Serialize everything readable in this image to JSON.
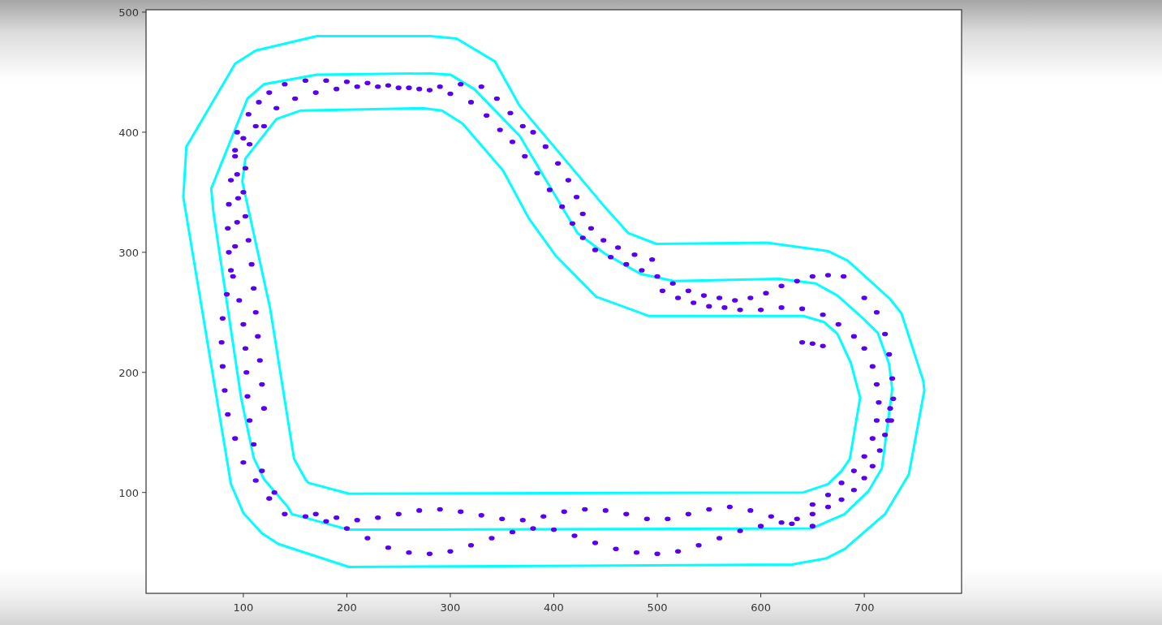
{
  "plot": {
    "chart_data": {
      "type": "scatter",
      "xlim": [
        6,
        794
      ],
      "ylim": [
        16,
        502
      ],
      "xticks": [
        100,
        200,
        300,
        400,
        500,
        600,
        700
      ],
      "yticks": [
        100,
        200,
        300,
        400,
        500
      ],
      "x": [
        725,
        723,
        720,
        715,
        708,
        700,
        690,
        678,
        665,
        650,
        635,
        620,
        600,
        580,
        560,
        540,
        520,
        500,
        480,
        460,
        440,
        420,
        400,
        380,
        360,
        340,
        320,
        300,
        280,
        260,
        240,
        220,
        200,
        180,
        160,
        140,
        650,
        630,
        610,
        590,
        570,
        550,
        530,
        510,
        490,
        470,
        450,
        430,
        410,
        390,
        370,
        350,
        330,
        310,
        290,
        270,
        250,
        230,
        210,
        190,
        170,
        125,
        112,
        100,
        92,
        85,
        82,
        80,
        79,
        80,
        84,
        88,
        92,
        94,
        95,
        94,
        92,
        94,
        130,
        118,
        110,
        106,
        104,
        103,
        102,
        100,
        96,
        90,
        86,
        85,
        86,
        88,
        92,
        100,
        120,
        118,
        116,
        114,
        112,
        110,
        108,
        105,
        102,
        100,
        102,
        106,
        112,
        105,
        115,
        125,
        140,
        160,
        180,
        200,
        220,
        240,
        260,
        280,
        300,
        320,
        335,
        348,
        120,
        132,
        150,
        170,
        190,
        210,
        230,
        250,
        270,
        290,
        310,
        330,
        345,
        358,
        370,
        360,
        372,
        384,
        396,
        408,
        418,
        428,
        440,
        455,
        470,
        485,
        380,
        392,
        404,
        414,
        422,
        428,
        436,
        448,
        462,
        478,
        495,
        500,
        515,
        530,
        545,
        560,
        575,
        590,
        605,
        620,
        635,
        650,
        665,
        680,
        505,
        520,
        535,
        550,
        565,
        580,
        600,
        620,
        640,
        660,
        675,
        690,
        700,
        708,
        712,
        714,
        712,
        708,
        700,
        690,
        678,
        665,
        650,
        640,
        650,
        660,
        700,
        712,
        720,
        724,
        727,
        728,
        726
      ],
      "series": [
        {
          "color": "#5a00f0",
          "values": [
            170,
            160,
            148,
            135,
            122,
            112,
            102,
            94,
            88,
            82,
            78,
            75,
            72,
            68,
            62,
            56,
            51,
            49,
            50,
            53,
            58,
            64,
            69,
            70,
            67,
            62,
            56,
            51,
            49,
            50,
            54,
            62,
            70,
            76,
            80,
            82,
            72,
            74,
            80,
            85,
            88,
            86,
            82,
            78,
            78,
            82,
            85,
            86,
            84,
            80,
            77,
            78,
            81,
            84,
            86,
            85,
            82,
            79,
            77,
            79,
            82,
            95,
            110,
            125,
            145,
            165,
            185,
            205,
            225,
            245,
            265,
            285,
            305,
            325,
            345,
            365,
            385,
            400,
            100,
            118,
            140,
            160,
            180,
            200,
            220,
            240,
            260,
            280,
            300,
            320,
            340,
            360,
            380,
            395,
            170,
            190,
            210,
            230,
            250,
            270,
            290,
            310,
            330,
            350,
            370,
            390,
            405,
            415,
            425,
            433,
            440,
            443,
            443,
            442,
            441,
            439,
            437,
            435,
            432,
            425,
            414,
            402,
            405,
            420,
            428,
            433,
            436,
            438,
            438,
            437,
            436,
            438,
            440,
            438,
            428,
            416,
            405,
            392,
            380,
            366,
            352,
            338,
            324,
            312,
            302,
            296,
            290,
            285,
            400,
            388,
            374,
            360,
            346,
            332,
            320,
            310,
            304,
            298,
            294,
            280,
            274,
            268,
            264,
            262,
            260,
            262,
            266,
            272,
            276,
            280,
            281,
            280,
            268,
            262,
            258,
            255,
            254,
            252,
            252,
            254,
            253,
            248,
            240,
            230,
            220,
            205,
            190,
            175,
            160,
            145,
            130,
            118,
            108,
            98,
            90,
            225,
            224,
            222,
            262,
            250,
            232,
            215,
            195,
            178,
            160
          ]
        }
      ]
    }
  }
}
